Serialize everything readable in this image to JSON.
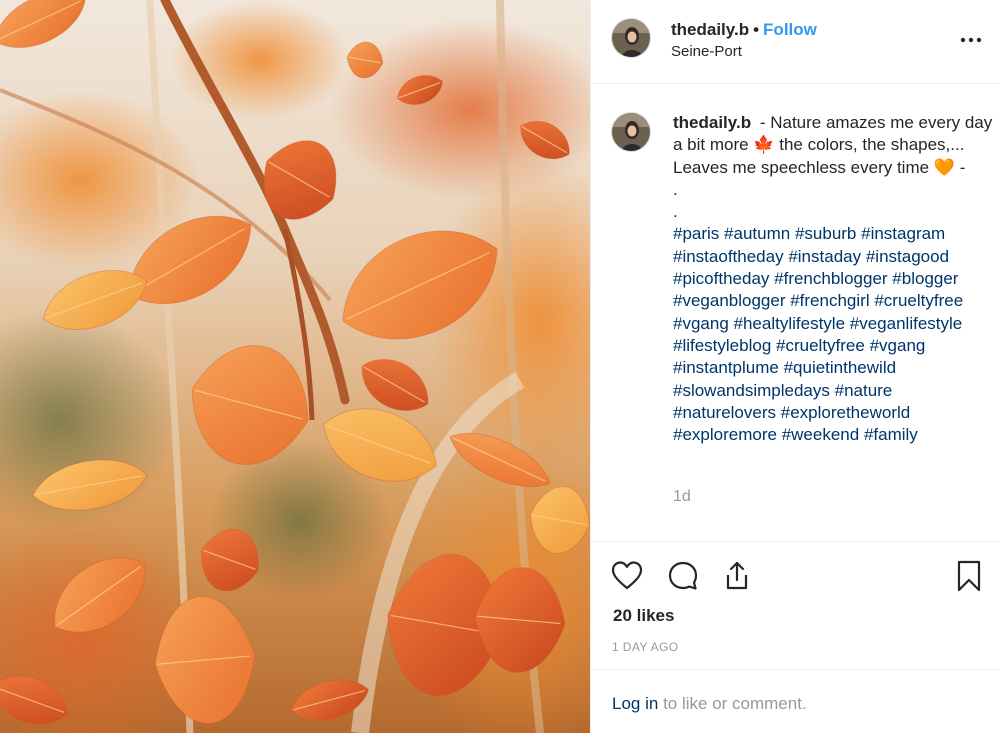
{
  "post": {
    "username": "thedaily.b",
    "separator": "•",
    "follow_label": "Follow",
    "location": "Seine-Port",
    "more_icon": "more-horizontal-icon"
  },
  "caption": {
    "username": "thedaily.b",
    "text_1": "- Nature amazes me every day a bit more",
    "emoji_1": "🍁",
    "text_2": "the colors, the shapes,... Leaves me speechless every time",
    "emoji_2": "🧡",
    "text_3": "-",
    "dot_1": ".",
    "dot_2": ".",
    "hashtags": [
      "#paris",
      "#autumn",
      "#suburb",
      "#instagram",
      "#instaoftheday",
      "#instaday",
      "#instagood",
      "#picoftheday",
      "#frenchblogger",
      "#blogger",
      "#veganblogger",
      "#frenchgirl",
      "#crueltyfree",
      "#vgang",
      "#healtylifestyle",
      "#veganlifestyle",
      "#lifestyleblog",
      "#crueltyfree",
      "#vgang",
      "#instantplume",
      "#quietinthewild",
      "#slowandsimpledays",
      "#nature",
      "#naturelovers",
      "#exploretheworld",
      "#exploremore",
      "#weekend",
      "#family"
    ],
    "time_ago": "1d"
  },
  "actions": {
    "like_icon": "heart-icon",
    "comment_icon": "comment-icon",
    "share_icon": "share-icon",
    "save_icon": "bookmark-icon",
    "likes_label": "20 likes",
    "date_label": "1 DAY AGO"
  },
  "login": {
    "link_label": "Log in",
    "rest_label": "to like or comment."
  },
  "colors": {
    "link_blue": "#3897f0",
    "hashtag_navy": "#003569",
    "muted_gray": "#999999",
    "text_dark": "#262626",
    "border": "#efefef"
  }
}
